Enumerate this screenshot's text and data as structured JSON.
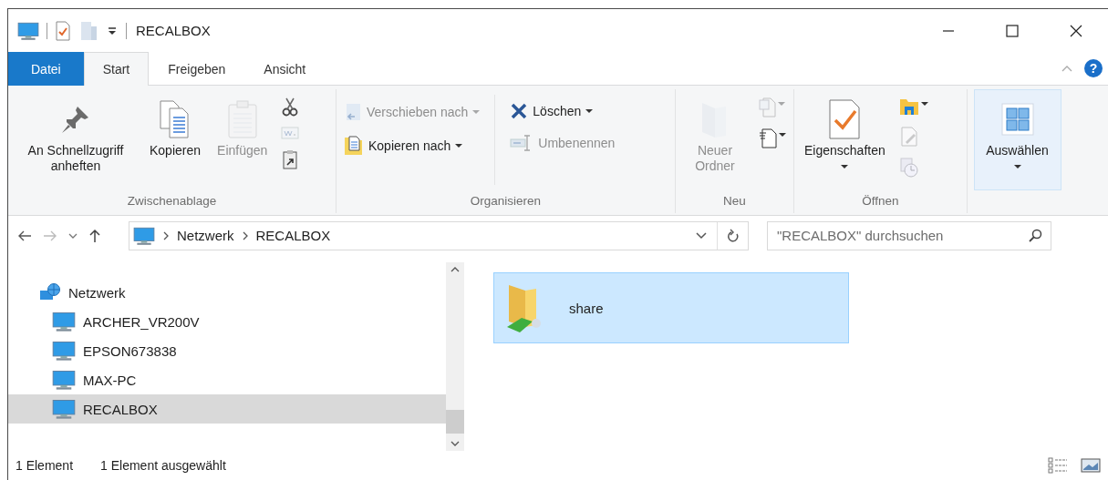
{
  "window": {
    "title": "RECALBOX"
  },
  "ribbon_tabs": [
    {
      "label": "Datei",
      "kind": "file",
      "selected": false
    },
    {
      "label": "Start",
      "kind": "tab",
      "selected": true
    },
    {
      "label": "Freigeben",
      "kind": "tab",
      "selected": false
    },
    {
      "label": "Ansicht",
      "kind": "tab",
      "selected": false
    }
  ],
  "help": {
    "label": "?"
  },
  "ribbon_groups": [
    {
      "label": "Zwischenablage",
      "columns": [
        {
          "kind": "large",
          "label": "An Schnellzugriff anheften",
          "disabled": false,
          "dropdown": false,
          "highlighted": false
        },
        {
          "kind": "large",
          "label": "Kopieren",
          "disabled": false,
          "dropdown": false,
          "highlighted": false
        },
        {
          "kind": "large",
          "label": "Einfügen",
          "disabled": true,
          "dropdown": false,
          "highlighted": false
        },
        {
          "kind": "icons",
          "items": [
            {
              "disabled": false,
              "dropdown": false
            },
            {
              "disabled": true,
              "dropdown": false
            },
            {
              "disabled": false,
              "dropdown": false
            }
          ]
        }
      ]
    },
    {
      "label": "Organisieren",
      "columns": [
        {
          "kind": "small",
          "items": [
            {
              "label": "Verschieben nach",
              "disabled": true,
              "dropdown": true
            },
            {
              "label": "Kopieren nach",
              "disabled": false,
              "dropdown": true
            }
          ]
        },
        {
          "kind": "separator"
        },
        {
          "kind": "small",
          "items": [
            {
              "label": "Löschen",
              "disabled": false,
              "dropdown": true
            },
            {
              "label": "Umbenennen",
              "disabled": true,
              "dropdown": false
            }
          ]
        }
      ]
    },
    {
      "label": "Neu",
      "columns": [
        {
          "kind": "large",
          "label": "Neuer Ordner",
          "disabled": true,
          "dropdown": false,
          "highlighted": false
        },
        {
          "kind": "icons",
          "items": [
            {
              "disabled": true,
              "dropdown": true
            },
            {
              "disabled": false,
              "dropdown": true
            }
          ]
        }
      ]
    },
    {
      "label": "Öffnen",
      "columns": [
        {
          "kind": "large",
          "label": "Eigenschaften",
          "disabled": false,
          "dropdown": true,
          "highlighted": false
        },
        {
          "kind": "icons",
          "items": [
            {
              "disabled": false,
              "dropdown": true
            },
            {
              "disabled": true,
              "dropdown": false
            },
            {
              "disabled": true,
              "dropdown": false
            }
          ]
        }
      ]
    },
    {
      "columns": [
        {
          "kind": "large",
          "label": "Auswählen",
          "disabled": false,
          "dropdown": true,
          "highlighted": true
        }
      ]
    }
  ],
  "address": {
    "breadcrumbs": [
      "Netzwerk",
      "RECALBOX"
    ]
  },
  "search": {
    "placeholder": "\"RECALBOX\" durchsuchen"
  },
  "navigation": {
    "items": [
      {
        "label": "Netzwerk",
        "selected": false,
        "children": [
          {
            "label": "ARCHER_VR200V",
            "selected": false
          },
          {
            "label": "EPSON673838",
            "selected": false
          },
          {
            "label": "MAX-PC",
            "selected": false
          },
          {
            "label": "RECALBOX",
            "selected": true
          }
        ]
      }
    ]
  },
  "content": {
    "items": [
      {
        "label": "share",
        "selected": true
      }
    ]
  },
  "status_bar": {
    "item_count": "1 Element",
    "selection": "1 Element ausgewählt"
  }
}
